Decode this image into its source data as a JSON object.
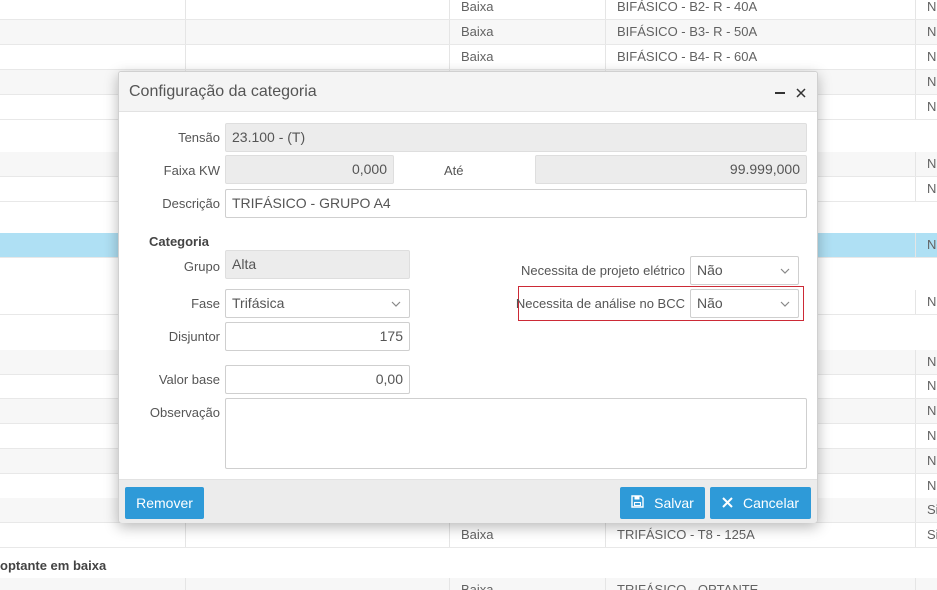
{
  "background": {
    "rows": [
      {
        "c3": "Baixa",
        "c4": "BIFÁSICO - B2- R - 40A",
        "c5": "N"
      },
      {
        "c3": "Baixa",
        "c4": "BIFÁSICO - B3- R - 50A",
        "c5": "N"
      },
      {
        "c3": "Baixa",
        "c4": "BIFÁSICO - B4- R - 60A",
        "c5": "N"
      },
      {
        "c3": "",
        "c4": "",
        "c5": "N"
      },
      {
        "c3": "",
        "c4": "",
        "c5": "N"
      },
      {
        "c3": "",
        "c4": "",
        "c5": "N"
      },
      {
        "c3": "",
        "c4": "",
        "c5": "N"
      },
      {
        "c3": "",
        "c4": "",
        "c5": "N"
      },
      {
        "c3": "",
        "c4": "",
        "c5": "N"
      },
      {
        "c3": "",
        "c4": "",
        "c5": "N"
      },
      {
        "c3": "",
        "c4": "",
        "c5": "N"
      },
      {
        "c3": "",
        "c4": "",
        "c5": "N"
      },
      {
        "c3": "",
        "c4": "",
        "c5": "N"
      },
      {
        "c3": "",
        "c4": "",
        "c5": "N"
      },
      {
        "c3": "",
        "c4": "",
        "c5": "N"
      },
      {
        "c3": "",
        "c4": "",
        "c5": "Si"
      },
      {
        "c3": "Baixa",
        "c4": "TRIFÁSICO - T8 - 125A",
        "c5": "Si"
      },
      {
        "c3": "Baixa",
        "c4": "TRIFÁSICO - OPTANTE",
        "c5": ""
      }
    ],
    "group_heading": "optante em baixa"
  },
  "modal": {
    "title": "Configuração da categoria",
    "minimize_icon": "minus-icon",
    "close_icon": "close-icon",
    "tensao": {
      "label": "Tensão",
      "value": "23.100 - (T)"
    },
    "faixa_kw": {
      "label": "Faixa KW",
      "value": "0,000"
    },
    "ate": {
      "label": "Até",
      "value": "99.999,000"
    },
    "descricao": {
      "label": "Descrição",
      "value": "TRIFÁSICO - GRUPO A4"
    },
    "categoria_section": "Categoria",
    "grupo": {
      "label": "Grupo",
      "value": "Alta"
    },
    "fase": {
      "label": "Fase",
      "value": "Trifásica"
    },
    "disjuntor": {
      "label": "Disjuntor",
      "value": "175"
    },
    "valor_base": {
      "label": "Valor base",
      "value": "0,00"
    },
    "observacao": {
      "label": "Observação",
      "value": ""
    },
    "projeto_eletrico": {
      "label": "Necessita de projeto elétrico",
      "value": "Não"
    },
    "analise_bcc": {
      "label": "Necessita de análise no BCC",
      "value": "Não"
    },
    "buttons": {
      "remover": "Remover",
      "salvar": "Salvar",
      "cancelar": "Cancelar"
    }
  },
  "colors": {
    "primary_button": "#2e9ad8",
    "highlight_border": "#cc2a36",
    "selected_row": "#a9def4"
  }
}
